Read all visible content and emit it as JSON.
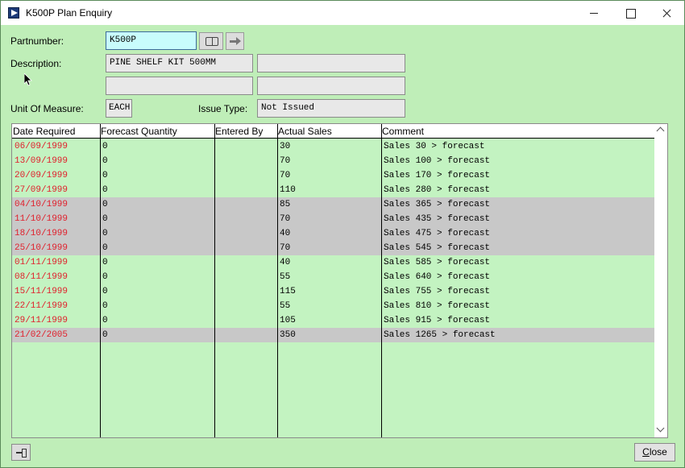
{
  "window": {
    "title": "K500P Plan Enquiry"
  },
  "form": {
    "partnumber_label": "Partnumber:",
    "partnumber_value": "K500P",
    "description_label": "Description:",
    "description_value": "PINE SHELF KIT 500MM",
    "description_2": "",
    "description_3": "",
    "description_4": "",
    "uom_label": "Unit Of Measure:",
    "uom_value": "EACH",
    "issue_type_label": "Issue Type:",
    "issue_type_value": "Not Issued"
  },
  "grid": {
    "columns": [
      "Date Required",
      "Forecast Quantity",
      "Entered By",
      "Actual Sales",
      "Comment"
    ],
    "rows": [
      {
        "date": "06/09/1999",
        "forecast": "0",
        "entered_by": "",
        "actual": "30",
        "comment": "Sales 30 > forecast",
        "grey": false
      },
      {
        "date": "13/09/1999",
        "forecast": "0",
        "entered_by": "",
        "actual": "70",
        "comment": "Sales 100 > forecast",
        "grey": false
      },
      {
        "date": "20/09/1999",
        "forecast": "0",
        "entered_by": "",
        "actual": "70",
        "comment": "Sales 170 > forecast",
        "grey": false
      },
      {
        "date": "27/09/1999",
        "forecast": "0",
        "entered_by": "",
        "actual": "110",
        "comment": "Sales 280 > forecast",
        "grey": false
      },
      {
        "date": "04/10/1999",
        "forecast": "0",
        "entered_by": "",
        "actual": "85",
        "comment": "Sales 365 > forecast",
        "grey": true
      },
      {
        "date": "11/10/1999",
        "forecast": "0",
        "entered_by": "",
        "actual": "70",
        "comment": "Sales 435 > forecast",
        "grey": true
      },
      {
        "date": "18/10/1999",
        "forecast": "0",
        "entered_by": "",
        "actual": "40",
        "comment": "Sales 475 > forecast",
        "grey": true
      },
      {
        "date": "25/10/1999",
        "forecast": "0",
        "entered_by": "",
        "actual": "70",
        "comment": "Sales 545 > forecast",
        "grey": true
      },
      {
        "date": "01/11/1999",
        "forecast": "0",
        "entered_by": "",
        "actual": "40",
        "comment": "Sales 585 > forecast",
        "grey": false
      },
      {
        "date": "08/11/1999",
        "forecast": "0",
        "entered_by": "",
        "actual": "55",
        "comment": "Sales 640 > forecast",
        "grey": false
      },
      {
        "date": "15/11/1999",
        "forecast": "0",
        "entered_by": "",
        "actual": "115",
        "comment": "Sales 755 > forecast",
        "grey": false
      },
      {
        "date": "22/11/1999",
        "forecast": "0",
        "entered_by": "",
        "actual": "55",
        "comment": "Sales 810 > forecast",
        "grey": false
      },
      {
        "date": "29/11/1999",
        "forecast": "0",
        "entered_by": "",
        "actual": "105",
        "comment": "Sales 915 > forecast",
        "grey": false
      },
      {
        "date": "21/02/2005",
        "forecast": "0",
        "entered_by": "",
        "actual": "350",
        "comment": "Sales 1265 > forecast",
        "grey": true
      }
    ]
  },
  "footer": {
    "close_label": "Close"
  },
  "colors": {
    "background": "#bfeeb8",
    "date_text": "#e0202c",
    "grey_row": "#c8c8c8",
    "input_bg": "#c8fcfc"
  },
  "icons": [
    "app-icon",
    "book-icon",
    "arrow-right-icon",
    "pin-icon",
    "scroll-up-icon",
    "scroll-down-icon"
  ]
}
